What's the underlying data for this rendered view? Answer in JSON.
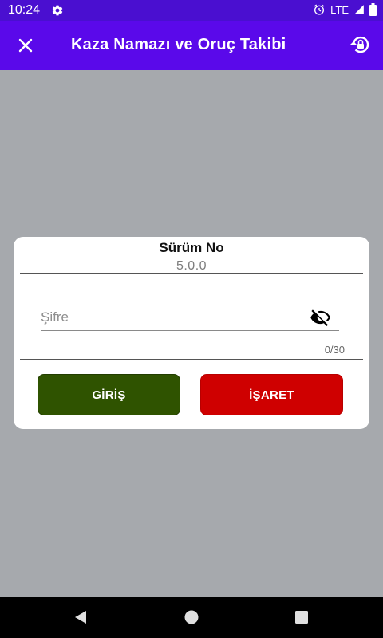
{
  "status_bar": {
    "time": "10:24",
    "network": "LTE",
    "icons": [
      "gear-icon",
      "alarm-icon",
      "signal-icon",
      "battery-icon"
    ]
  },
  "app_bar": {
    "title": "Kaza Namazı ve Oruç Takibi",
    "left_icon": "close-icon",
    "right_icon": "restore-lock-icon",
    "color": "#5a09ea"
  },
  "dialog": {
    "title": "Sürüm No",
    "version": "5.0.0",
    "password": {
      "placeholder": "Şifre",
      "value": "",
      "counter": "0/30",
      "icon": "eye-off-icon"
    },
    "buttons": {
      "login_label": "GİRİŞ",
      "login_color": "#2f5300",
      "mark_label": "İŞARET",
      "mark_color": "#cf0000"
    }
  },
  "nav_bar": {
    "icons": [
      "back-icon",
      "home-icon",
      "recents-icon"
    ]
  }
}
